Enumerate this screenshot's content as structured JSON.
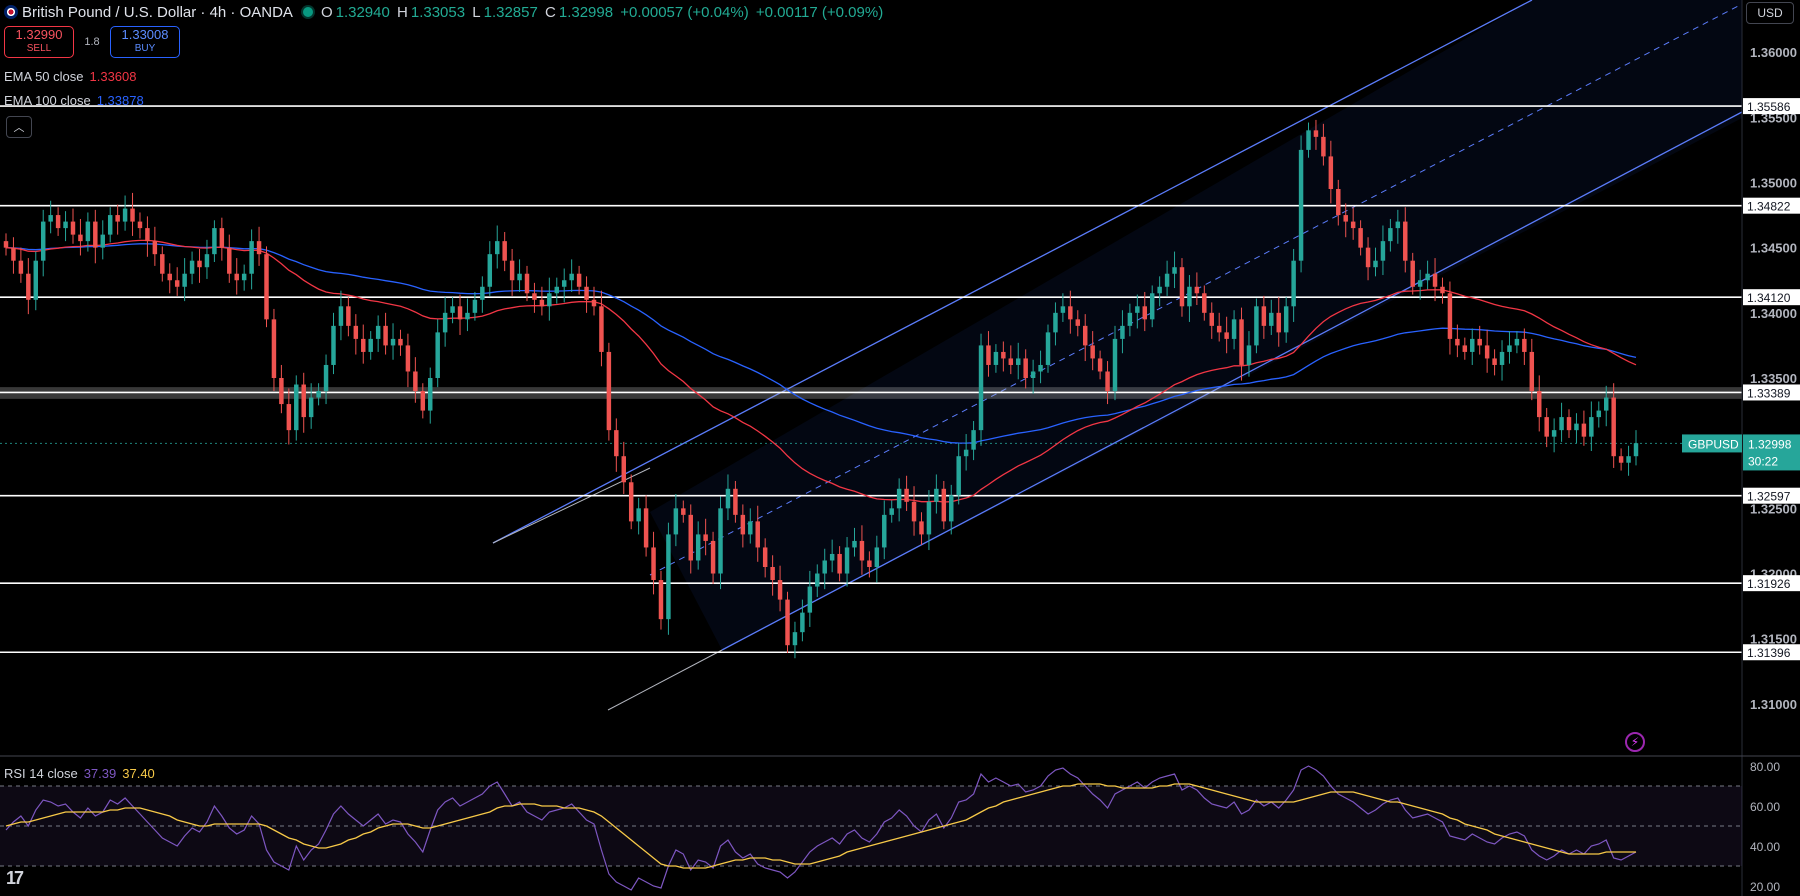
{
  "header": {
    "symbol": "British Pound / U.S. Dollar · 4h · OANDA",
    "o_label": "O",
    "o": "1.32940",
    "h_label": "H",
    "h": "1.33053",
    "l_label": "L",
    "l": "1.32857",
    "c_label": "C",
    "c": "1.32998",
    "change": "+0.00057 (+0.04%)",
    "change2": "+0.00117 (+0.09%)"
  },
  "trade": {
    "sell_price": "1.32990",
    "sell_label": "SELL",
    "spread": "1.8",
    "buy_price": "1.33008",
    "buy_label": "BUY"
  },
  "indicators": {
    "ema50_label": "EMA 50 close",
    "ema50_value": "1.33608",
    "ema100_label": "EMA 100 close",
    "ema100_value": "1.33878",
    "rsi_label": "RSI 14 close",
    "rsi_value": "37.39",
    "rsi_ma_value": "37.40"
  },
  "currency": "USD",
  "logo": "17",
  "colors": {
    "up": "#26a69a",
    "down": "#ef5350",
    "ema50": "#f23645",
    "ema100": "#2962ff",
    "channel": "#5b7cfa",
    "rsi": "#7e57c2",
    "rsi_ma": "#f7c948",
    "level": "#ffffff",
    "price_tag": "#26a69a"
  },
  "chart_data": [
    {
      "type": "candlestick",
      "symbol": "GBPUSD",
      "ylim": [
        1.306,
        1.364
      ],
      "y_ticks": [
        "1.36000",
        "1.35500",
        "1.35000",
        "1.34500",
        "1.34000",
        "1.33500",
        "1.32500",
        "1.32000",
        "1.31500",
        "1.31000"
      ],
      "last_price": "1.32998",
      "countdown": "30:22",
      "price_levels": [
        "1.35586",
        "1.34822",
        "1.34120",
        "1.33389",
        "1.32597",
        "1.31926",
        "1.31396"
      ],
      "close": [
        1.345,
        1.344,
        1.343,
        1.341,
        1.344,
        1.347,
        1.3475,
        1.3465,
        1.347,
        1.346,
        1.3455,
        1.347,
        1.345,
        1.346,
        1.3475,
        1.347,
        1.348,
        1.347,
        1.3465,
        1.3455,
        1.3445,
        1.343,
        1.3425,
        1.342,
        1.343,
        1.344,
        1.3435,
        1.3445,
        1.3465,
        1.345,
        1.343,
        1.3425,
        1.343,
        1.3455,
        1.3445,
        1.3395,
        1.335,
        1.333,
        1.331,
        1.3345,
        1.332,
        1.3335,
        1.334,
        1.336,
        1.339,
        1.3405,
        1.339,
        1.338,
        1.337,
        1.338,
        1.339,
        1.3375,
        1.338,
        1.3375,
        1.3355,
        1.334,
        1.3325,
        1.335,
        1.3385,
        1.34,
        1.3405,
        1.3395,
        1.34,
        1.341,
        1.342,
        1.3445,
        1.3455,
        1.344,
        1.3425,
        1.343,
        1.3415,
        1.341,
        1.3405,
        1.3415,
        1.342,
        1.3425,
        1.343,
        1.342,
        1.341,
        1.3405,
        1.337,
        1.331,
        1.329,
        1.327,
        1.324,
        1.325,
        1.322,
        1.3195,
        1.3165,
        1.323,
        1.325,
        1.3245,
        1.321,
        1.323,
        1.3225,
        1.32,
        1.325,
        1.3265,
        1.3245,
        1.323,
        1.324,
        1.322,
        1.3205,
        1.3195,
        1.318,
        1.3145,
        1.3155,
        1.317,
        1.319,
        1.32,
        1.321,
        1.3215,
        1.32,
        1.322,
        1.3225,
        1.321,
        1.3205,
        1.322,
        1.3245,
        1.325,
        1.3265,
        1.3255,
        1.324,
        1.323,
        1.3255,
        1.3265,
        1.324,
        1.326,
        1.329,
        1.3295,
        1.331,
        1.3375,
        1.336,
        1.337,
        1.3365,
        1.336,
        1.3365,
        1.335,
        1.3355,
        1.336,
        1.3385,
        1.34,
        1.3405,
        1.3395,
        1.339,
        1.3375,
        1.3365,
        1.3355,
        1.334,
        1.338,
        1.339,
        1.34,
        1.3405,
        1.3395,
        1.3415,
        1.342,
        1.343,
        1.3435,
        1.3405,
        1.342,
        1.3415,
        1.34,
        1.339,
        1.3385,
        1.338,
        1.3395,
        1.336,
        1.3375,
        1.3405,
        1.339,
        1.34,
        1.3385,
        1.3405,
        1.344,
        1.3525,
        1.354,
        1.3535,
        1.352,
        1.3495,
        1.3475,
        1.347,
        1.3465,
        1.345,
        1.3435,
        1.344,
        1.3455,
        1.3465,
        1.347,
        1.344,
        1.342,
        1.3425,
        1.343,
        1.342,
        1.3415,
        1.338,
        1.3375,
        1.337,
        1.338,
        1.3375,
        1.3365,
        1.336,
        1.337,
        1.3375,
        1.338,
        1.337,
        1.334,
        1.332,
        1.3305,
        1.331,
        1.332,
        1.331,
        1.3315,
        1.3305,
        1.332,
        1.3325,
        1.3335,
        1.329,
        1.3285,
        1.329,
        1.33
      ]
    },
    {
      "type": "line",
      "title": "RSI 14 close",
      "ylim": [
        15,
        85
      ],
      "y_ticks": [
        "80.00",
        "60.00",
        "40.00",
        "20.00"
      ],
      "bands": [
        70,
        50,
        30
      ],
      "series": [
        {
          "name": "RSI",
          "values": [
            48,
            52,
            55,
            50,
            58,
            63,
            62,
            60,
            61,
            57,
            54,
            59,
            55,
            57,
            63,
            61,
            64,
            60,
            56,
            52,
            48,
            44,
            42,
            40,
            45,
            49,
            47,
            52,
            60,
            55,
            49,
            46,
            48,
            55,
            51,
            38,
            32,
            30,
            28,
            40,
            33,
            38,
            41,
            48,
            56,
            60,
            56,
            53,
            50,
            53,
            56,
            51,
            53,
            52,
            46,
            42,
            37,
            48,
            58,
            62,
            64,
            60,
            62,
            64,
            66,
            70,
            72,
            66,
            60,
            62,
            57,
            55,
            53,
            57,
            58,
            59,
            61,
            57,
            53,
            51,
            38,
            26,
            22,
            20,
            18,
            24,
            22,
            20,
            19,
            30,
            38,
            36,
            28,
            33,
            32,
            29,
            40,
            43,
            37,
            34,
            36,
            31,
            29,
            28,
            27,
            24,
            27,
            32,
            37,
            40,
            42,
            44,
            41,
            46,
            48,
            44,
            42,
            46,
            52,
            54,
            58,
            55,
            50,
            47,
            53,
            56,
            49,
            54,
            62,
            63,
            66,
            76,
            72,
            74,
            72,
            70,
            71,
            67,
            68,
            70,
            75,
            78,
            79,
            76,
            74,
            70,
            66,
            63,
            59,
            66,
            68,
            70,
            72,
            69,
            72,
            74,
            75,
            76,
            68,
            70,
            68,
            64,
            61,
            60,
            59,
            62,
            56,
            58,
            63,
            60,
            62,
            59,
            63,
            68,
            78,
            80,
            78,
            75,
            70,
            66,
            64,
            62,
            59,
            56,
            58,
            61,
            63,
            64,
            58,
            54,
            55,
            56,
            54,
            52,
            45,
            44,
            43,
            46,
            44,
            42,
            41,
            44,
            46,
            47,
            45,
            38,
            35,
            33,
            35,
            38,
            36,
            38,
            36,
            40,
            41,
            43,
            34,
            33,
            35,
            37
          ]
        },
        {
          "name": "MA",
          "values": [
            50,
            51,
            52,
            52,
            53,
            54,
            55,
            56,
            57,
            57,
            57,
            57,
            57,
            57,
            58,
            58,
            59,
            59,
            59,
            58,
            57,
            56,
            55,
            53,
            52,
            51,
            50,
            50,
            51,
            51,
            51,
            51,
            51,
            51,
            51,
            50,
            48,
            46,
            44,
            43,
            41,
            40,
            39,
            39,
            40,
            41,
            43,
            44,
            46,
            47,
            49,
            50,
            51,
            51,
            51,
            50,
            49,
            49,
            50,
            51,
            52,
            53,
            54,
            55,
            56,
            57,
            59,
            60,
            60,
            61,
            61,
            61,
            60,
            60,
            60,
            59,
            59,
            59,
            58,
            57,
            55,
            52,
            49,
            46,
            43,
            40,
            37,
            34,
            31,
            30,
            30,
            29,
            29,
            29,
            29,
            30,
            31,
            32,
            33,
            33,
            34,
            34,
            34,
            33,
            33,
            32,
            31,
            31,
            31,
            32,
            33,
            34,
            35,
            37,
            38,
            39,
            40,
            41,
            42,
            43,
            44,
            45,
            46,
            47,
            48,
            49,
            50,
            51,
            52,
            53,
            55,
            57,
            59,
            60,
            62,
            63,
            64,
            65,
            66,
            67,
            68,
            69,
            70,
            70,
            71,
            71,
            71,
            71,
            70,
            70,
            69,
            69,
            69,
            69,
            69,
            70,
            70,
            71,
            71,
            71,
            70,
            69,
            68,
            67,
            66,
            65,
            64,
            63,
            62,
            62,
            62,
            62,
            62,
            62,
            63,
            64,
            65,
            66,
            67,
            67,
            67,
            67,
            66,
            65,
            64,
            63,
            62,
            62,
            61,
            60,
            59,
            58,
            57,
            56,
            54,
            53,
            51,
            50,
            49,
            48,
            46,
            45,
            44,
            43,
            42,
            41,
            40,
            39,
            38,
            37,
            36,
            36,
            36,
            36,
            36,
            37,
            37,
            37,
            37,
            37
          ]
        }
      ]
    }
  ]
}
